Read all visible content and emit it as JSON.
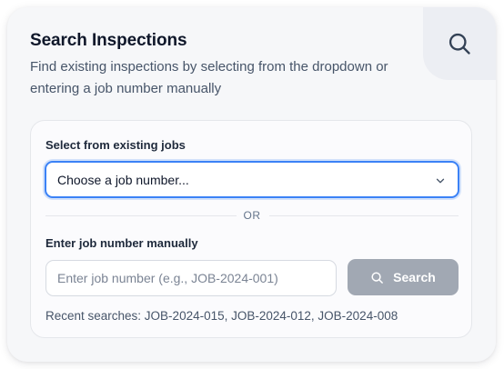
{
  "header": {
    "title": "Search Inspections",
    "subtitle": "Find existing inspections by selecting from the dropdown or entering a job number manually",
    "search_icon": "search-icon"
  },
  "select_section": {
    "label": "Select from existing jobs",
    "selected_value": "Choose a job number...",
    "dropdown_icon": "chevron-down-icon"
  },
  "divider": {
    "text": "OR"
  },
  "manual_section": {
    "label": "Enter job number manually",
    "input_value": "",
    "input_placeholder": "Enter job number (e.g., JOB-2024-001)",
    "button_label": "Search",
    "button_icon": "search-icon"
  },
  "recent": {
    "text": "Recent searches: JOB-2024-015, JOB-2024-012, JOB-2024-008"
  },
  "colors": {
    "focus_border": "#3b82f6",
    "button_disabled": "#a1a8b3",
    "title_text": "#0f172a",
    "muted_text": "#475569"
  }
}
